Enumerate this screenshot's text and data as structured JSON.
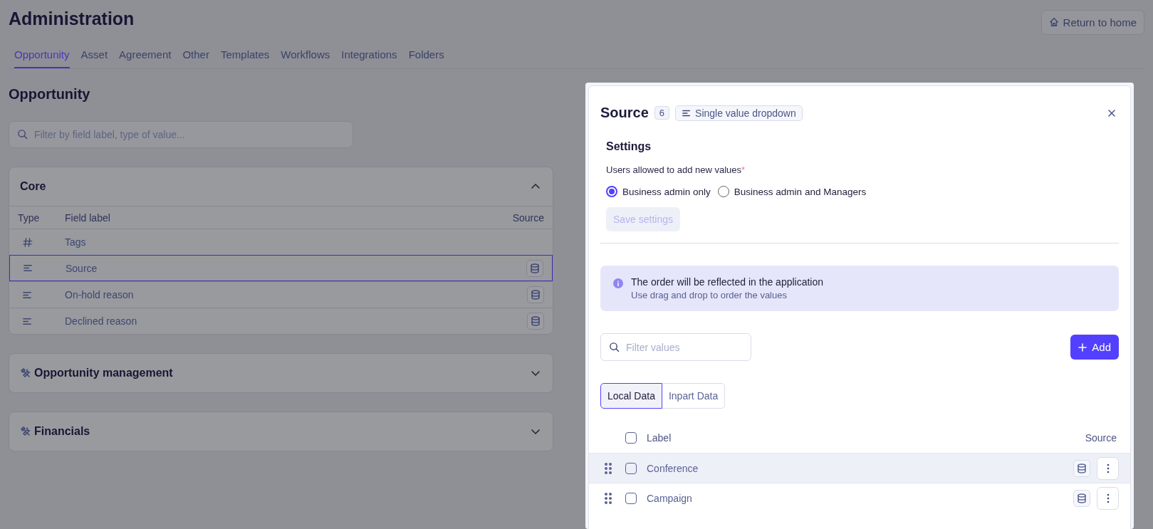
{
  "header": {
    "title": "Administration",
    "return_button": "Return to home"
  },
  "tabs": [
    {
      "label": "Opportunity",
      "selected": true
    },
    {
      "label": "Asset",
      "selected": false
    },
    {
      "label": "Agreement",
      "selected": false
    },
    {
      "label": "Other",
      "selected": false
    },
    {
      "label": "Templates",
      "selected": false
    },
    {
      "label": "Workflows",
      "selected": false
    },
    {
      "label": "Integrations",
      "selected": false
    },
    {
      "label": "Folders",
      "selected": false
    }
  ],
  "section_title": "Opportunity",
  "search": {
    "placeholder": "Filter by field label, type of value..."
  },
  "groups": [
    {
      "title": "Core",
      "has_icon": false,
      "expanded": true,
      "columns": [
        "Type",
        "Field label",
        "Source"
      ],
      "rows": [
        {
          "kind": "number",
          "label": "Tags",
          "has_source": false,
          "selected": false
        },
        {
          "kind": "list",
          "label": "Source",
          "has_source": true,
          "selected": true
        },
        {
          "kind": "list",
          "label": "On-hold reason",
          "has_source": true,
          "selected": false
        },
        {
          "kind": "list",
          "label": "Declined reason",
          "has_source": true,
          "selected": false
        }
      ]
    },
    {
      "title": "Opportunity management",
      "has_icon": true,
      "expanded": false
    },
    {
      "title": "Financials",
      "has_icon": true,
      "expanded": false
    }
  ],
  "panel": {
    "title": "Source",
    "count": "6",
    "type_tag": "Single value dropdown",
    "settings": {
      "title": "Settings",
      "label": "Users allowed to add new values",
      "required_mark": "*",
      "options": [
        {
          "label": "Business admin only",
          "selected": true
        },
        {
          "label": "Business admin and Managers",
          "selected": false
        }
      ],
      "save_button": {
        "label": "Save settings",
        "disabled": true
      }
    },
    "info": {
      "title": "The order will be reflected in the application",
      "text": "Use drag and drop to order the values"
    },
    "filter": {
      "placeholder": "Filter values"
    },
    "add_button": "Add",
    "data_tabs": [
      {
        "label": "Local Data",
        "selected": true
      },
      {
        "label": "Inpart Data",
        "selected": false
      }
    ],
    "columns": [
      "Label",
      "Source"
    ],
    "select_all_checked": false,
    "rows": [
      {
        "label": "Conference",
        "checked": false,
        "has_source": true,
        "highlighted": true
      },
      {
        "label": "Campaign",
        "checked": false,
        "has_source": true,
        "highlighted": false
      }
    ]
  }
}
